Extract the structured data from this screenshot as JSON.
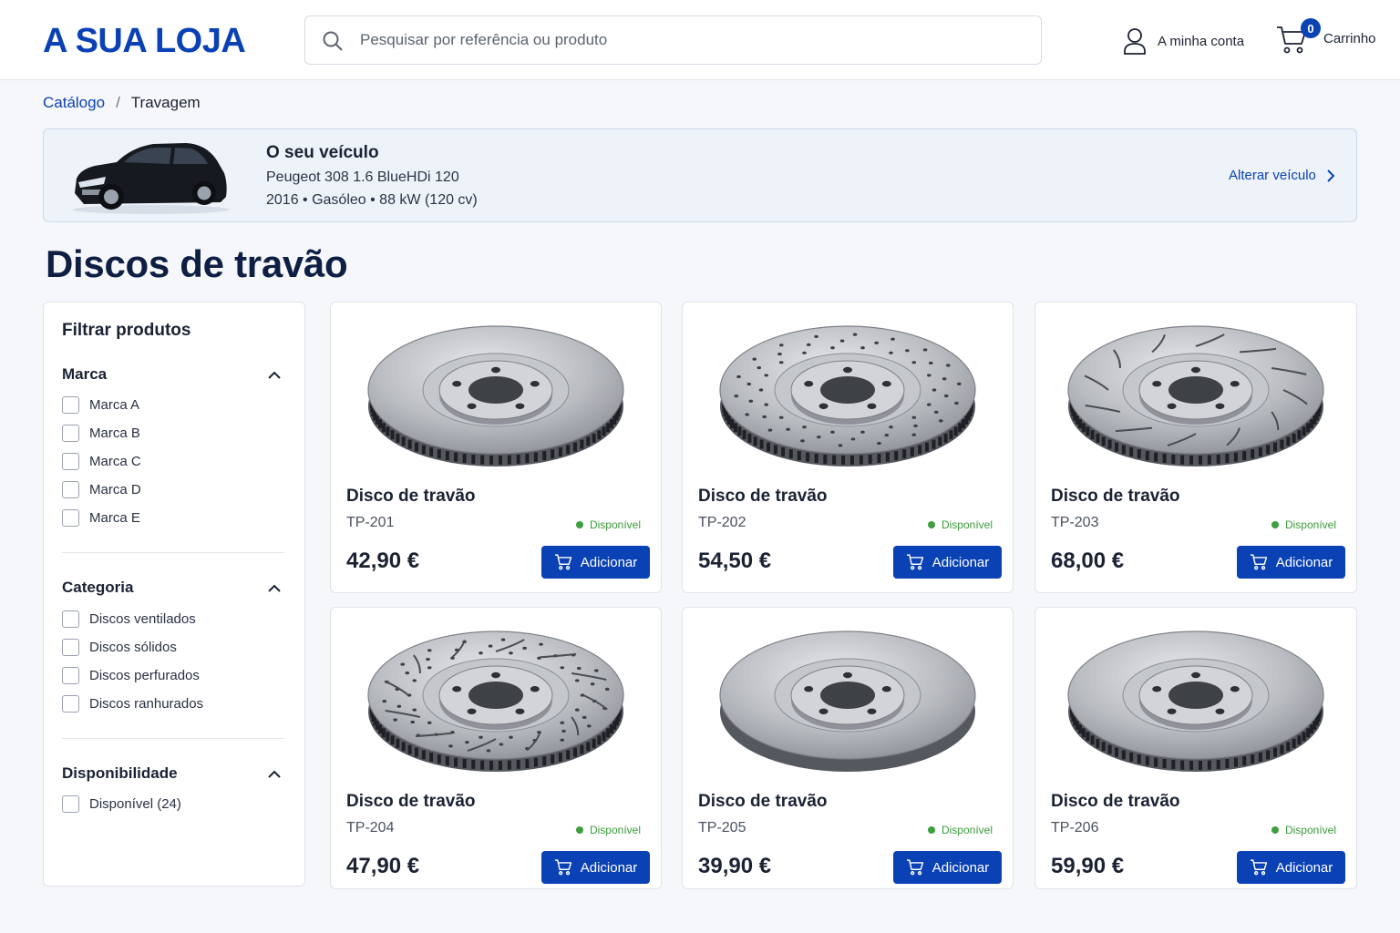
{
  "header": {
    "logo": "A SUA LOJA",
    "search_placeholder": "Pesquisar por referência ou produto",
    "account_label": "A minha conta",
    "cart_label": "Carrinho",
    "cart_count": "0"
  },
  "breadcrumb": {
    "catalog": "Catálogo",
    "separator": "/",
    "current": "Travagem"
  },
  "vehicle": {
    "title": "O seu veículo",
    "model": "Peugeot 308 1.6 BlueHDi 120",
    "specs": "2016 • Gasóleo • 88 kW (120 cv)",
    "change_label": "Alterar veículo"
  },
  "page_title": "Discos de travão",
  "filters": {
    "title": "Filtrar produtos",
    "groups": [
      {
        "title": "Marca",
        "options": [
          "Marca A",
          "Marca B",
          "Marca C",
          "Marca D",
          "Marca E"
        ]
      },
      {
        "title": "Categoria",
        "options": [
          "Discos ventilados",
          "Discos sólidos",
          "Discos perfurados",
          "Discos ranhurados"
        ]
      },
      {
        "title": "Disponibilidade",
        "options": [
          "Disponível (24)"
        ]
      }
    ]
  },
  "products": [
    {
      "name": "Disco de travão",
      "ref": "TP-201",
      "stock": "Disponível",
      "price": "42,90 €",
      "add_label": "Adicionar",
      "style": "plain"
    },
    {
      "name": "Disco de travão",
      "ref": "TP-202",
      "stock": "Disponível",
      "price": "54,50 €",
      "add_label": "Adicionar",
      "style": "drilled"
    },
    {
      "name": "Disco de travão",
      "ref": "TP-203",
      "stock": "Disponível",
      "price": "68,00 €",
      "add_label": "Adicionar",
      "style": "slotted"
    },
    {
      "name": "Disco de travão",
      "ref": "TP-204",
      "stock": "Disponível",
      "price": "47,90 €",
      "add_label": "Adicionar",
      "style": "drilled-slotted"
    },
    {
      "name": "Disco de travão",
      "ref": "TP-205",
      "stock": "Disponível",
      "price": "39,90 €",
      "add_label": "Adicionar",
      "style": "solid"
    },
    {
      "name": "Disco de travão",
      "ref": "TP-206",
      "stock": "Disponível",
      "price": "59,90 €",
      "add_label": "Adicionar",
      "style": "plain"
    }
  ],
  "colors": {
    "brand": "#0a41b5",
    "in_stock": "#3f9e3f",
    "title": "#0f1f44"
  }
}
